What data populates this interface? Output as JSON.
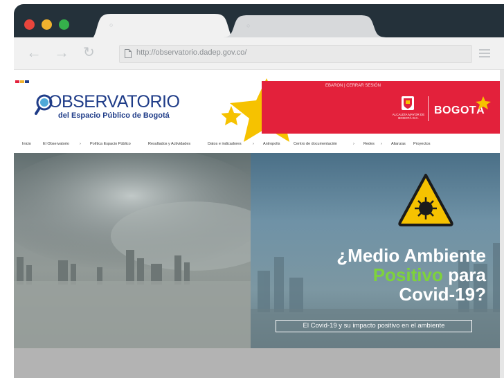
{
  "window": {
    "tabs": [
      {
        "label": "○",
        "active": true
      },
      {
        "label": "○",
        "active": false
      }
    ],
    "traffic_lights": [
      "#e8453c",
      "#f0b22e",
      "#35b04b"
    ]
  },
  "toolbar": {
    "back_label": "←",
    "forward_label": "→",
    "reload_label": "↻",
    "url": "http://observatorio.dadep.gov.co/"
  },
  "site": {
    "logo": {
      "title": "OBSERVATORIO",
      "subtitle": "del Espacio Público de Bogotá"
    },
    "session_links": "EBARON  |  CERRAR SESIÓN",
    "alcaldia": "ALCALDÍA MAYOR DE BOGOTÁ D.C.",
    "brand": "BOGOTÁ",
    "nav": [
      "Inicio",
      "El Observatorio",
      "Política Espacio Público",
      "Resultados y Actividades",
      "Datos e indicadores",
      "Antropolis",
      "Centro de documentación",
      "Redes",
      "Alianzas",
      "Proyectos"
    ],
    "hero": {
      "title_line1": "¿Medio Ambiente",
      "title_green": "Positivo",
      "title_line2_rest": " para",
      "title_line3": "Covid-19?",
      "subtitle": "El Covid-19 y su impacto positivo en el ambiente"
    }
  },
  "colors": {
    "frame": "#24313a",
    "brand_blue": "#1f3c88",
    "brand_red": "#e3213b",
    "accent_green": "#7ed23c",
    "warning_yellow": "#f6c200"
  }
}
